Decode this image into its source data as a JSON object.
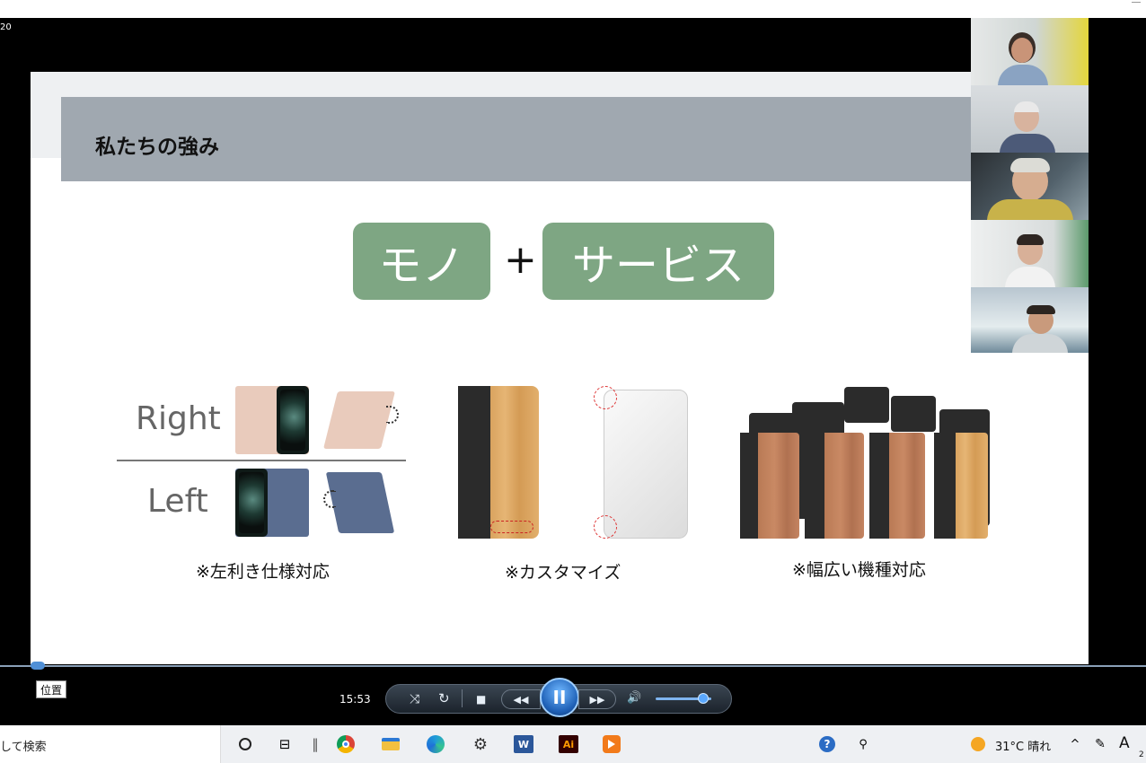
{
  "frame_number": "20",
  "slide": {
    "title": "私たちの強み",
    "pill_mono": "モノ",
    "plus": "+",
    "pill_service": "サービス",
    "right_label": "Right",
    "left_label": "Left",
    "caption_left_hand": "※左利き仕様対応",
    "caption_custom": "※カスタマイズ",
    "caption_models": "※幅広い機種対応"
  },
  "player": {
    "position_tooltip": "位置",
    "time": "15:53",
    "pause_glyph": "II",
    "rewind_glyph": "◀◀",
    "forward_glyph": "▶▶",
    "stop_glyph": "■",
    "volume_fraction": 0.85
  },
  "taskbar": {
    "search_text": "して検索",
    "weather": "31°C 晴れ",
    "ime_label": "A",
    "clock_fragment": "2",
    "word_label": "W",
    "illustrator_label": "Ai"
  },
  "colors": {
    "pill_green": "#7ea683",
    "title_bar": "#a0a8b0",
    "player_accent": "#1f61b7"
  }
}
